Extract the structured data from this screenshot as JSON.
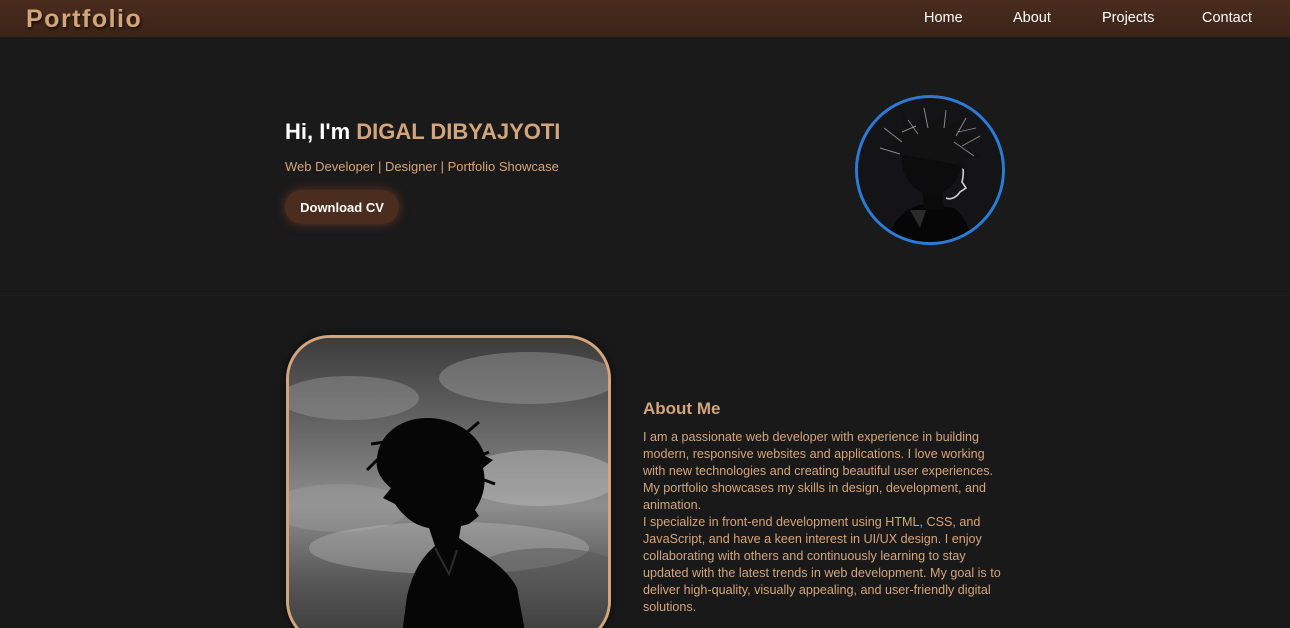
{
  "navbar": {
    "logo": "Portfolio",
    "links": [
      "Home",
      "About",
      "Projects",
      "Contact"
    ]
  },
  "hero": {
    "greeting": "Hi, I'm ",
    "name": "DIGAL DIBYAJYOTI",
    "subtitle": "Web Developer | Designer | Portfolio Showcase",
    "cv_button": "Download CV"
  },
  "about": {
    "heading": "About Me",
    "paragraph1": "I am a passionate web developer with experience in building modern, responsive websites and applications. I love working with new technologies and creating beautiful user experiences. My portfolio showcases my skills in design, development, and animation.",
    "paragraph2": "I specialize in front-end development using HTML, CSS, and JavaScript, and have a keen interest in UI/UX design. I enjoy collaborating with others and continuously learning to stay updated with the latest trends in web development. My goal is to deliver high-quality, visually appealing, and user-friendly digital solutions."
  },
  "colors": {
    "accent": "#d4a57a",
    "navbar": "#4a2c1e",
    "background": "#1a191a",
    "avatar_border": "#2b7bd6"
  }
}
